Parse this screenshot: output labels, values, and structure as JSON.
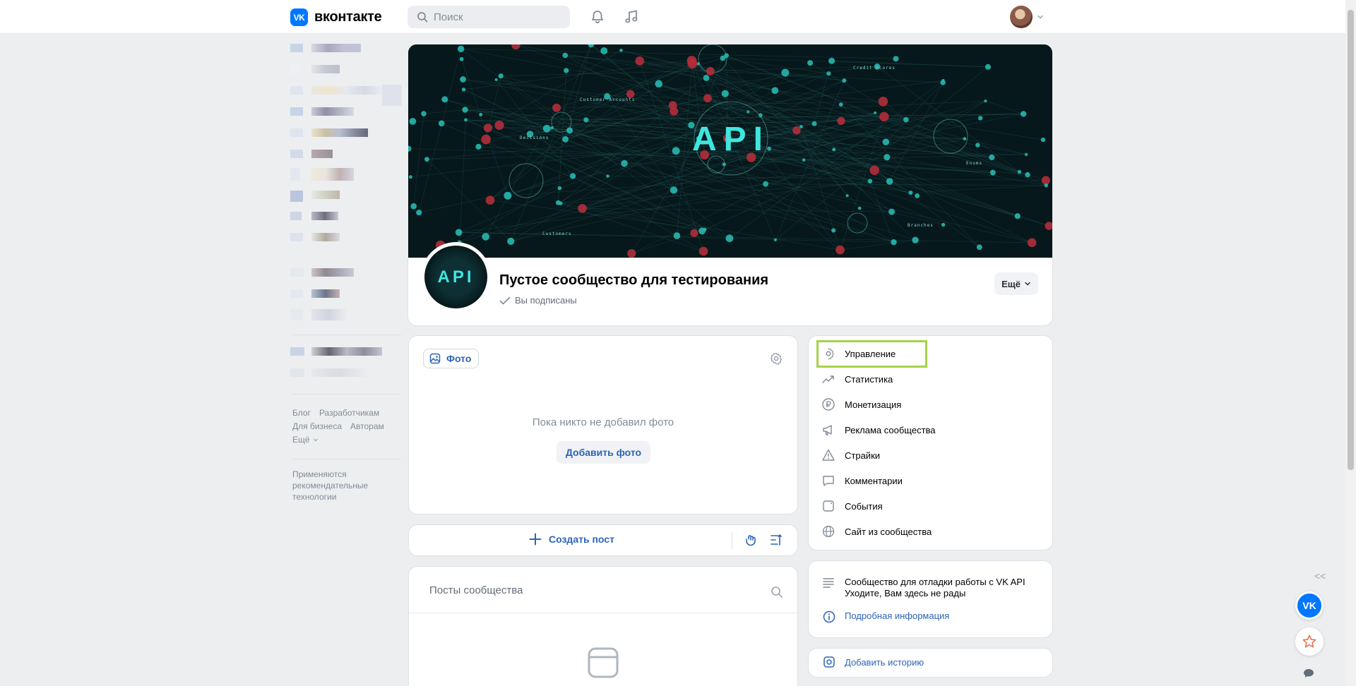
{
  "header": {
    "logo_text": "вконтакте",
    "logo_mark": "VK",
    "search_placeholder": "Поиск",
    "icons": [
      "bell-icon",
      "music-icon",
      "chevron-down-icon"
    ]
  },
  "sidebar": {
    "footer_links": [
      "Блог",
      "Разработчикам",
      "Для бизнеса",
      "Авторам",
      "Ещё"
    ],
    "recommendation_note": "Применяются рекомендательные технологии"
  },
  "group": {
    "cover_text": "API",
    "cover_labels": [
      "Decisions",
      "Customer Accounts",
      "Credit Scores",
      "Enums",
      "Branches",
      "Customers"
    ],
    "avatar_text": "API",
    "name": "Пустое сообщество для тестирования",
    "subscribed_label": "Вы подписаны",
    "more_label": "Ещё"
  },
  "photos": {
    "tab_label": "Фото",
    "empty_text": "Пока никто не добавил фото",
    "add_label": "Добавить фото"
  },
  "posts": {
    "create_label": "Создать пост",
    "title": "Посты сообщества"
  },
  "management_menu": {
    "items": [
      {
        "label": "Управление",
        "icon": "gear-icon"
      },
      {
        "label": "Статистика",
        "icon": "chart-icon"
      },
      {
        "label": "Монетизация",
        "icon": "ruble-icon"
      },
      {
        "label": "Реклама сообщества",
        "icon": "megaphone-icon"
      },
      {
        "label": "Страйки",
        "icon": "warning-icon"
      },
      {
        "label": "Комментарии",
        "icon": "comment-icon"
      },
      {
        "label": "События",
        "icon": "calendar-icon"
      },
      {
        "label": "Сайт из сообщества",
        "icon": "globe-icon"
      }
    ],
    "highlighted": "Управление"
  },
  "about": {
    "line1": "Сообщество для отладки работы с VK API",
    "line2": "Уходите, Вам здесь не рады",
    "more_info_label": "Подробная информация"
  },
  "story": {
    "add_label": "Добавить историю"
  },
  "floating": {
    "collapse_label": "<<",
    "vk_button": "VK"
  },
  "colors": {
    "accent": "#0077ff",
    "link": "#2d64b8",
    "highlight": "#a6d24a",
    "cover_text": "#3fe6e0"
  }
}
